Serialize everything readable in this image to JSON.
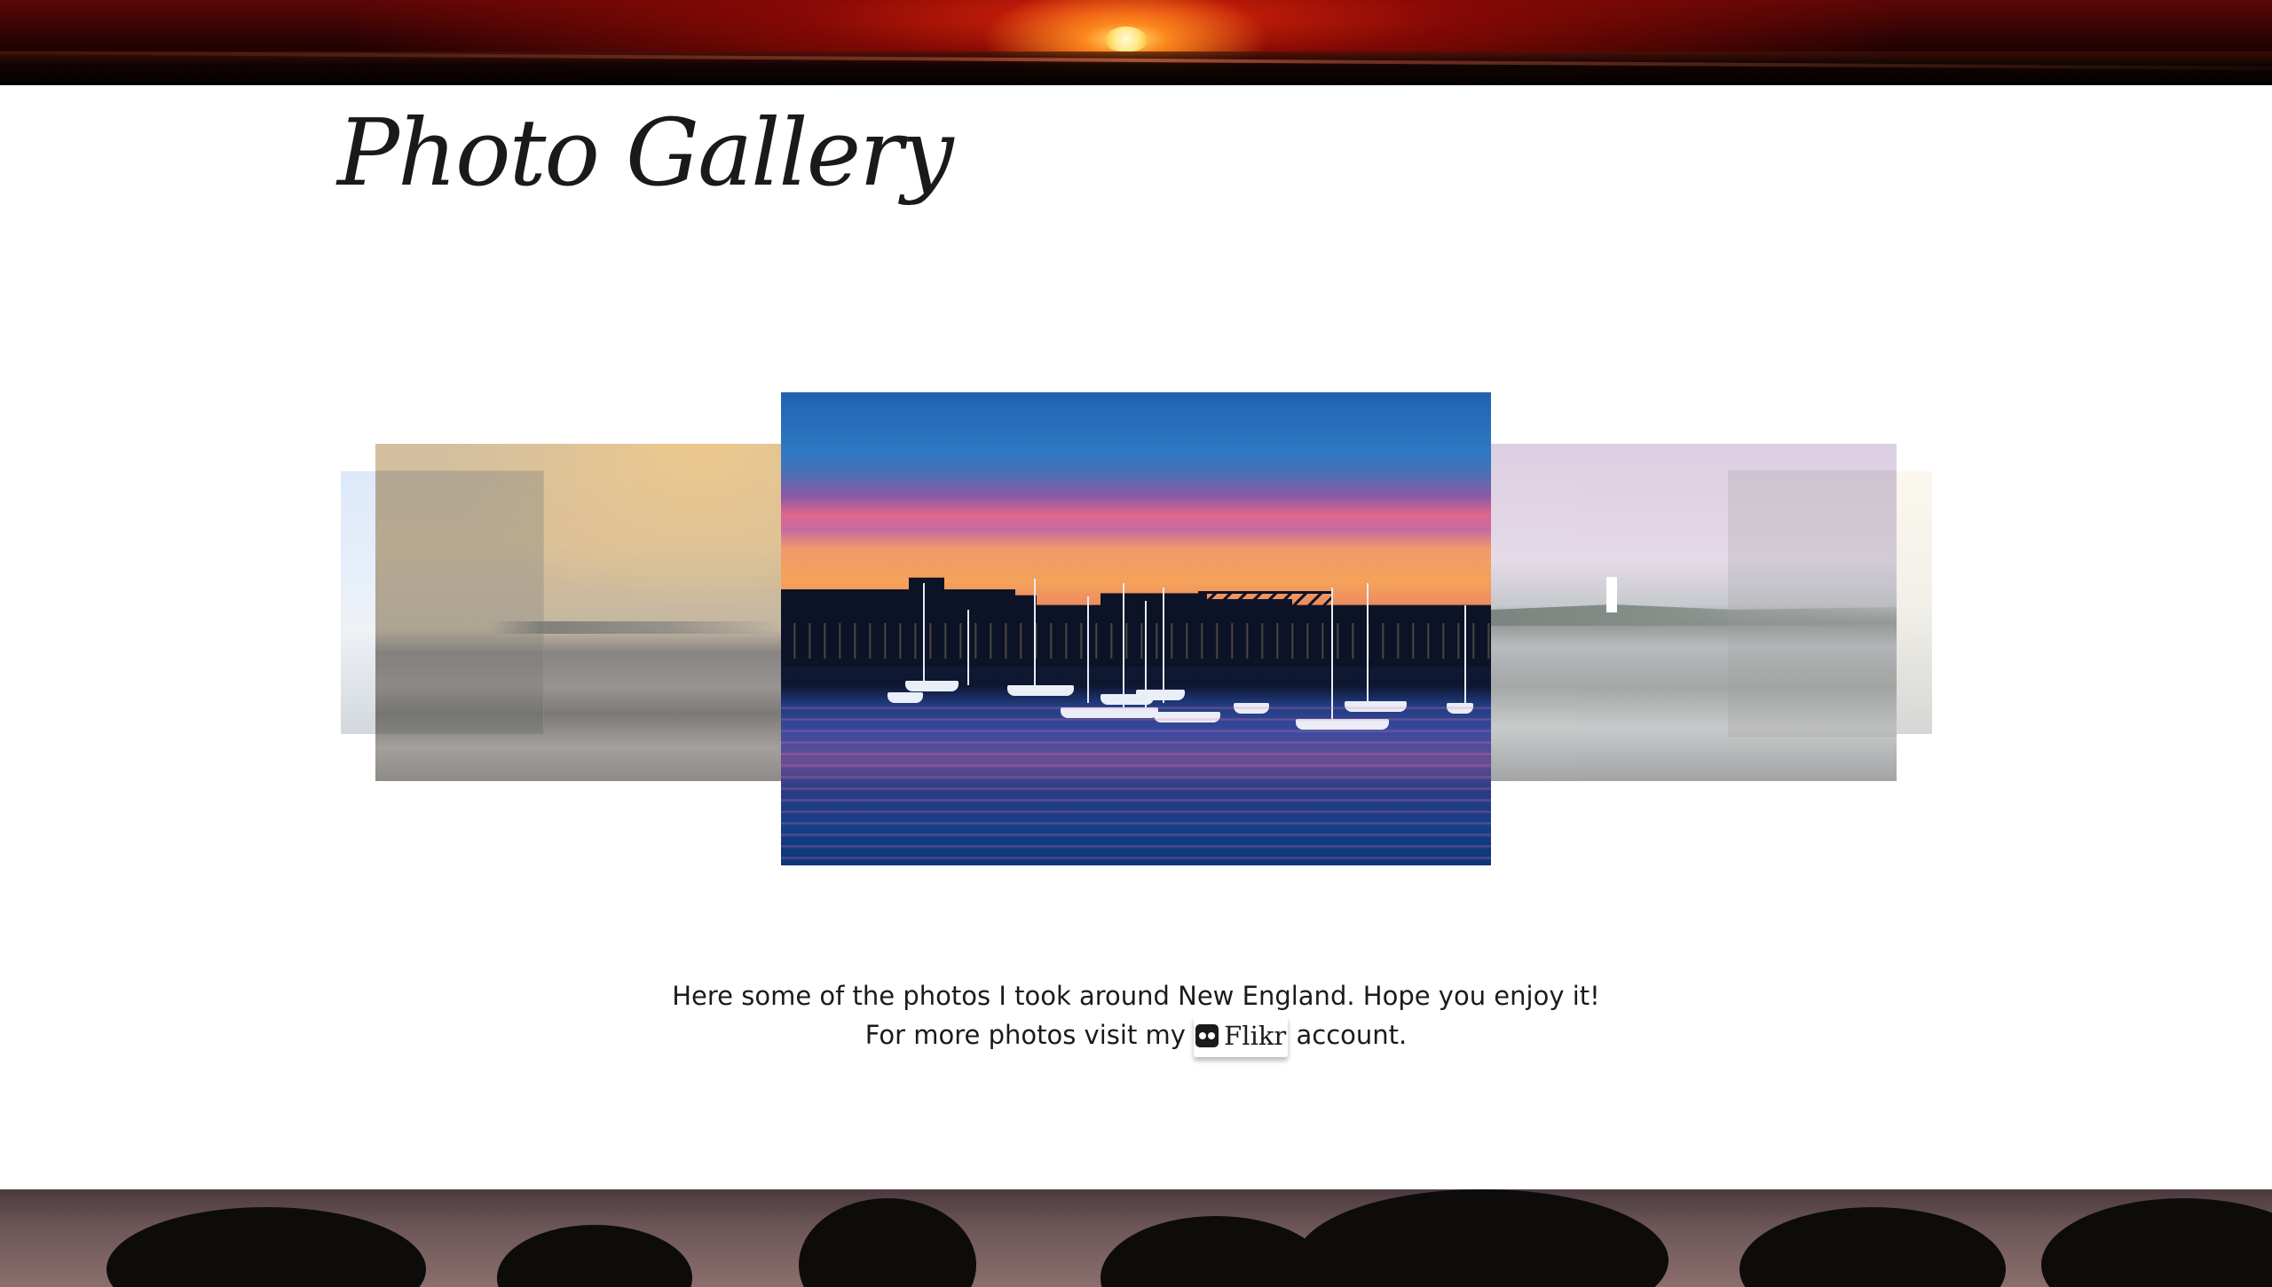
{
  "header": {
    "title": "Photo Gallery"
  },
  "gallery": {
    "slides": [
      {
        "name": "snowy-shore-photo",
        "position": "far-left"
      },
      {
        "name": "rocky-beach-sunset-photo",
        "position": "left"
      },
      {
        "name": "harbor-sunset-sailboats-photo",
        "position": "center"
      },
      {
        "name": "lighthouse-coast-photo",
        "position": "right"
      },
      {
        "name": "far-right-photo",
        "position": "far-right"
      }
    ]
  },
  "description": {
    "line1": "Here some of the photos I took around New England. Hope you enjoy it!",
    "line2_prefix": "For more photos visit my",
    "link_label": "Flikr",
    "line2_suffix": "account."
  },
  "icons": {
    "flickr": "flickr-icon"
  },
  "colors": {
    "text": "#1b1b1b",
    "background": "#ffffff"
  }
}
